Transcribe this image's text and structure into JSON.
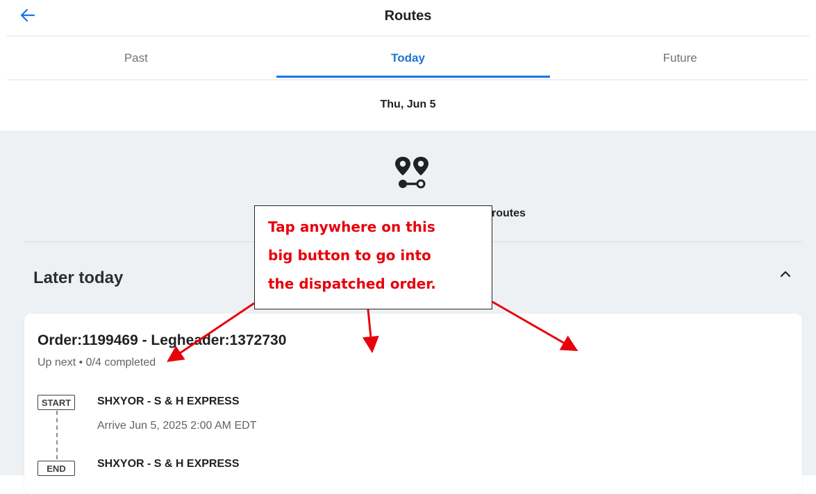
{
  "header": {
    "title": "Routes",
    "back_icon": "arrow-left-icon"
  },
  "tabs": [
    {
      "label": "Past",
      "active": false
    },
    {
      "label": "Today",
      "active": true
    },
    {
      "label": "Future",
      "active": false
    }
  ],
  "date_label": "Thu, Jun 5",
  "empty_state": {
    "icon": "route-pins-icon",
    "text": "routes"
  },
  "section": {
    "title": "Later today",
    "collapse_icon": "chevron-up-icon"
  },
  "order_card": {
    "title": "Order:1199469 - Legheader:1372730",
    "status": "Up next • 0/4 completed",
    "stops": [
      {
        "tag": "START",
        "name": "SHXYOR - S & H EXPRESS",
        "time": "Arrive Jun 5, 2025 2:00 AM EDT"
      },
      {
        "tag": "END",
        "name": "SHXYOR - S & H EXPRESS"
      }
    ]
  },
  "annotation": {
    "lines": [
      "Tap anywhere on this",
      "big button to go into",
      "the dispatched order."
    ],
    "color": "#e8000b"
  },
  "colors": {
    "accent": "#1a73e8",
    "background_content": "#eef1f4"
  }
}
